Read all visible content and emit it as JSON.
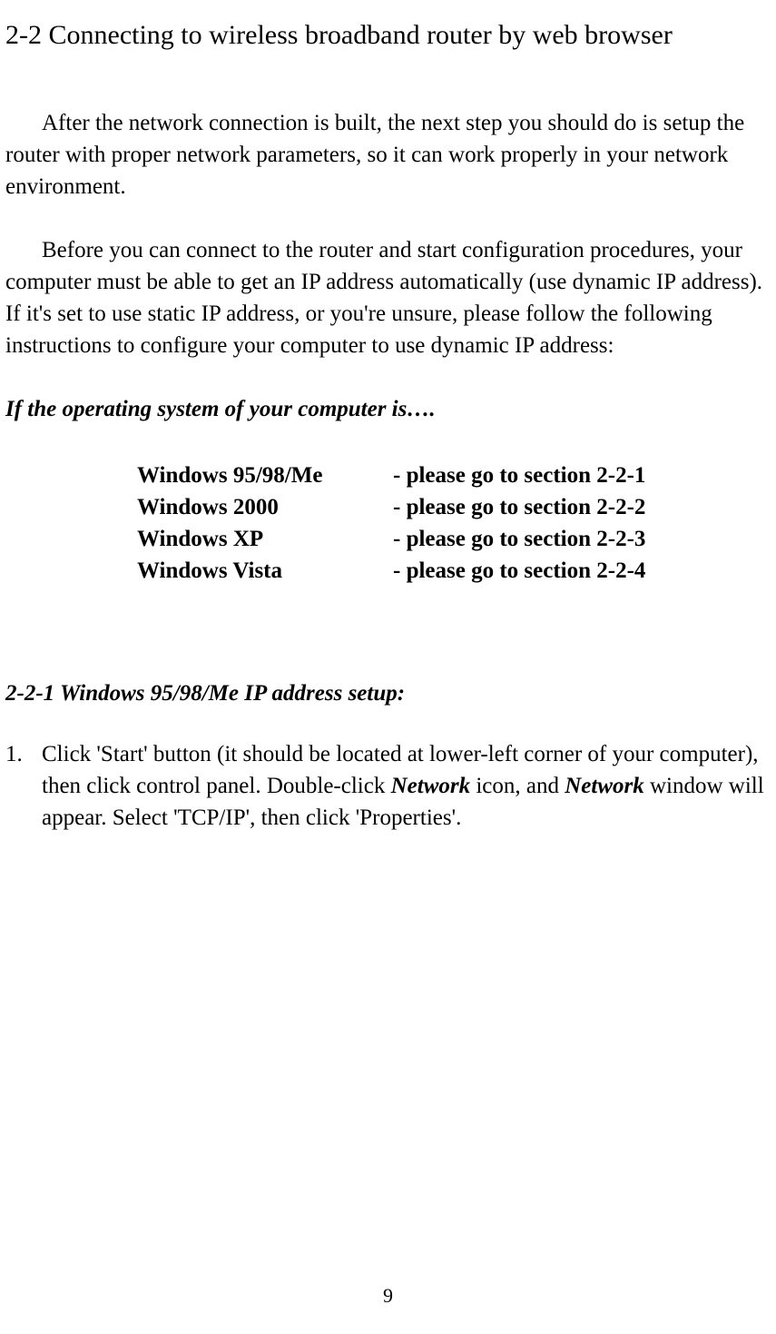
{
  "section_title": "2-2 Connecting to wireless broadband router by web browser",
  "para1": "After the network connection is built, the next step you should do is setup the router with proper network parameters, so it can work properly in your network environment.",
  "para2": "Before you can connect to the router and start configuration procedures, your computer must be able to get an IP address automatically (use dynamic IP address). If it's set to use static IP address, or you're unsure, please follow the following instructions to configure your computer to use dynamic IP address:",
  "os_heading": "If the operating system of your computer is….",
  "os_rows": [
    {
      "name": "Windows 95/98/Me",
      "action": "- please go to section 2-2-1"
    },
    {
      "name": "Windows 2000",
      "action": "- please go to section 2-2-2"
    },
    {
      "name": "Windows XP",
      "action": "- please go to section 2-2-3"
    },
    {
      "name": "Windows Vista",
      "action": "- please go to section 2-2-4"
    }
  ],
  "subsection_heading": "2-2-1 Windows 95/98/Me IP address setup:",
  "step1": {
    "num": "1.",
    "part1": "Click 'Start' button (it should be located at lower-left corner of your computer), then click control panel. Double-click ",
    "network1": "Network",
    "part2": " icon, and ",
    "network2": "Network",
    "part3": " window will appear. Select 'TCP/IP', then click 'Properties'."
  },
  "page_number": "9"
}
